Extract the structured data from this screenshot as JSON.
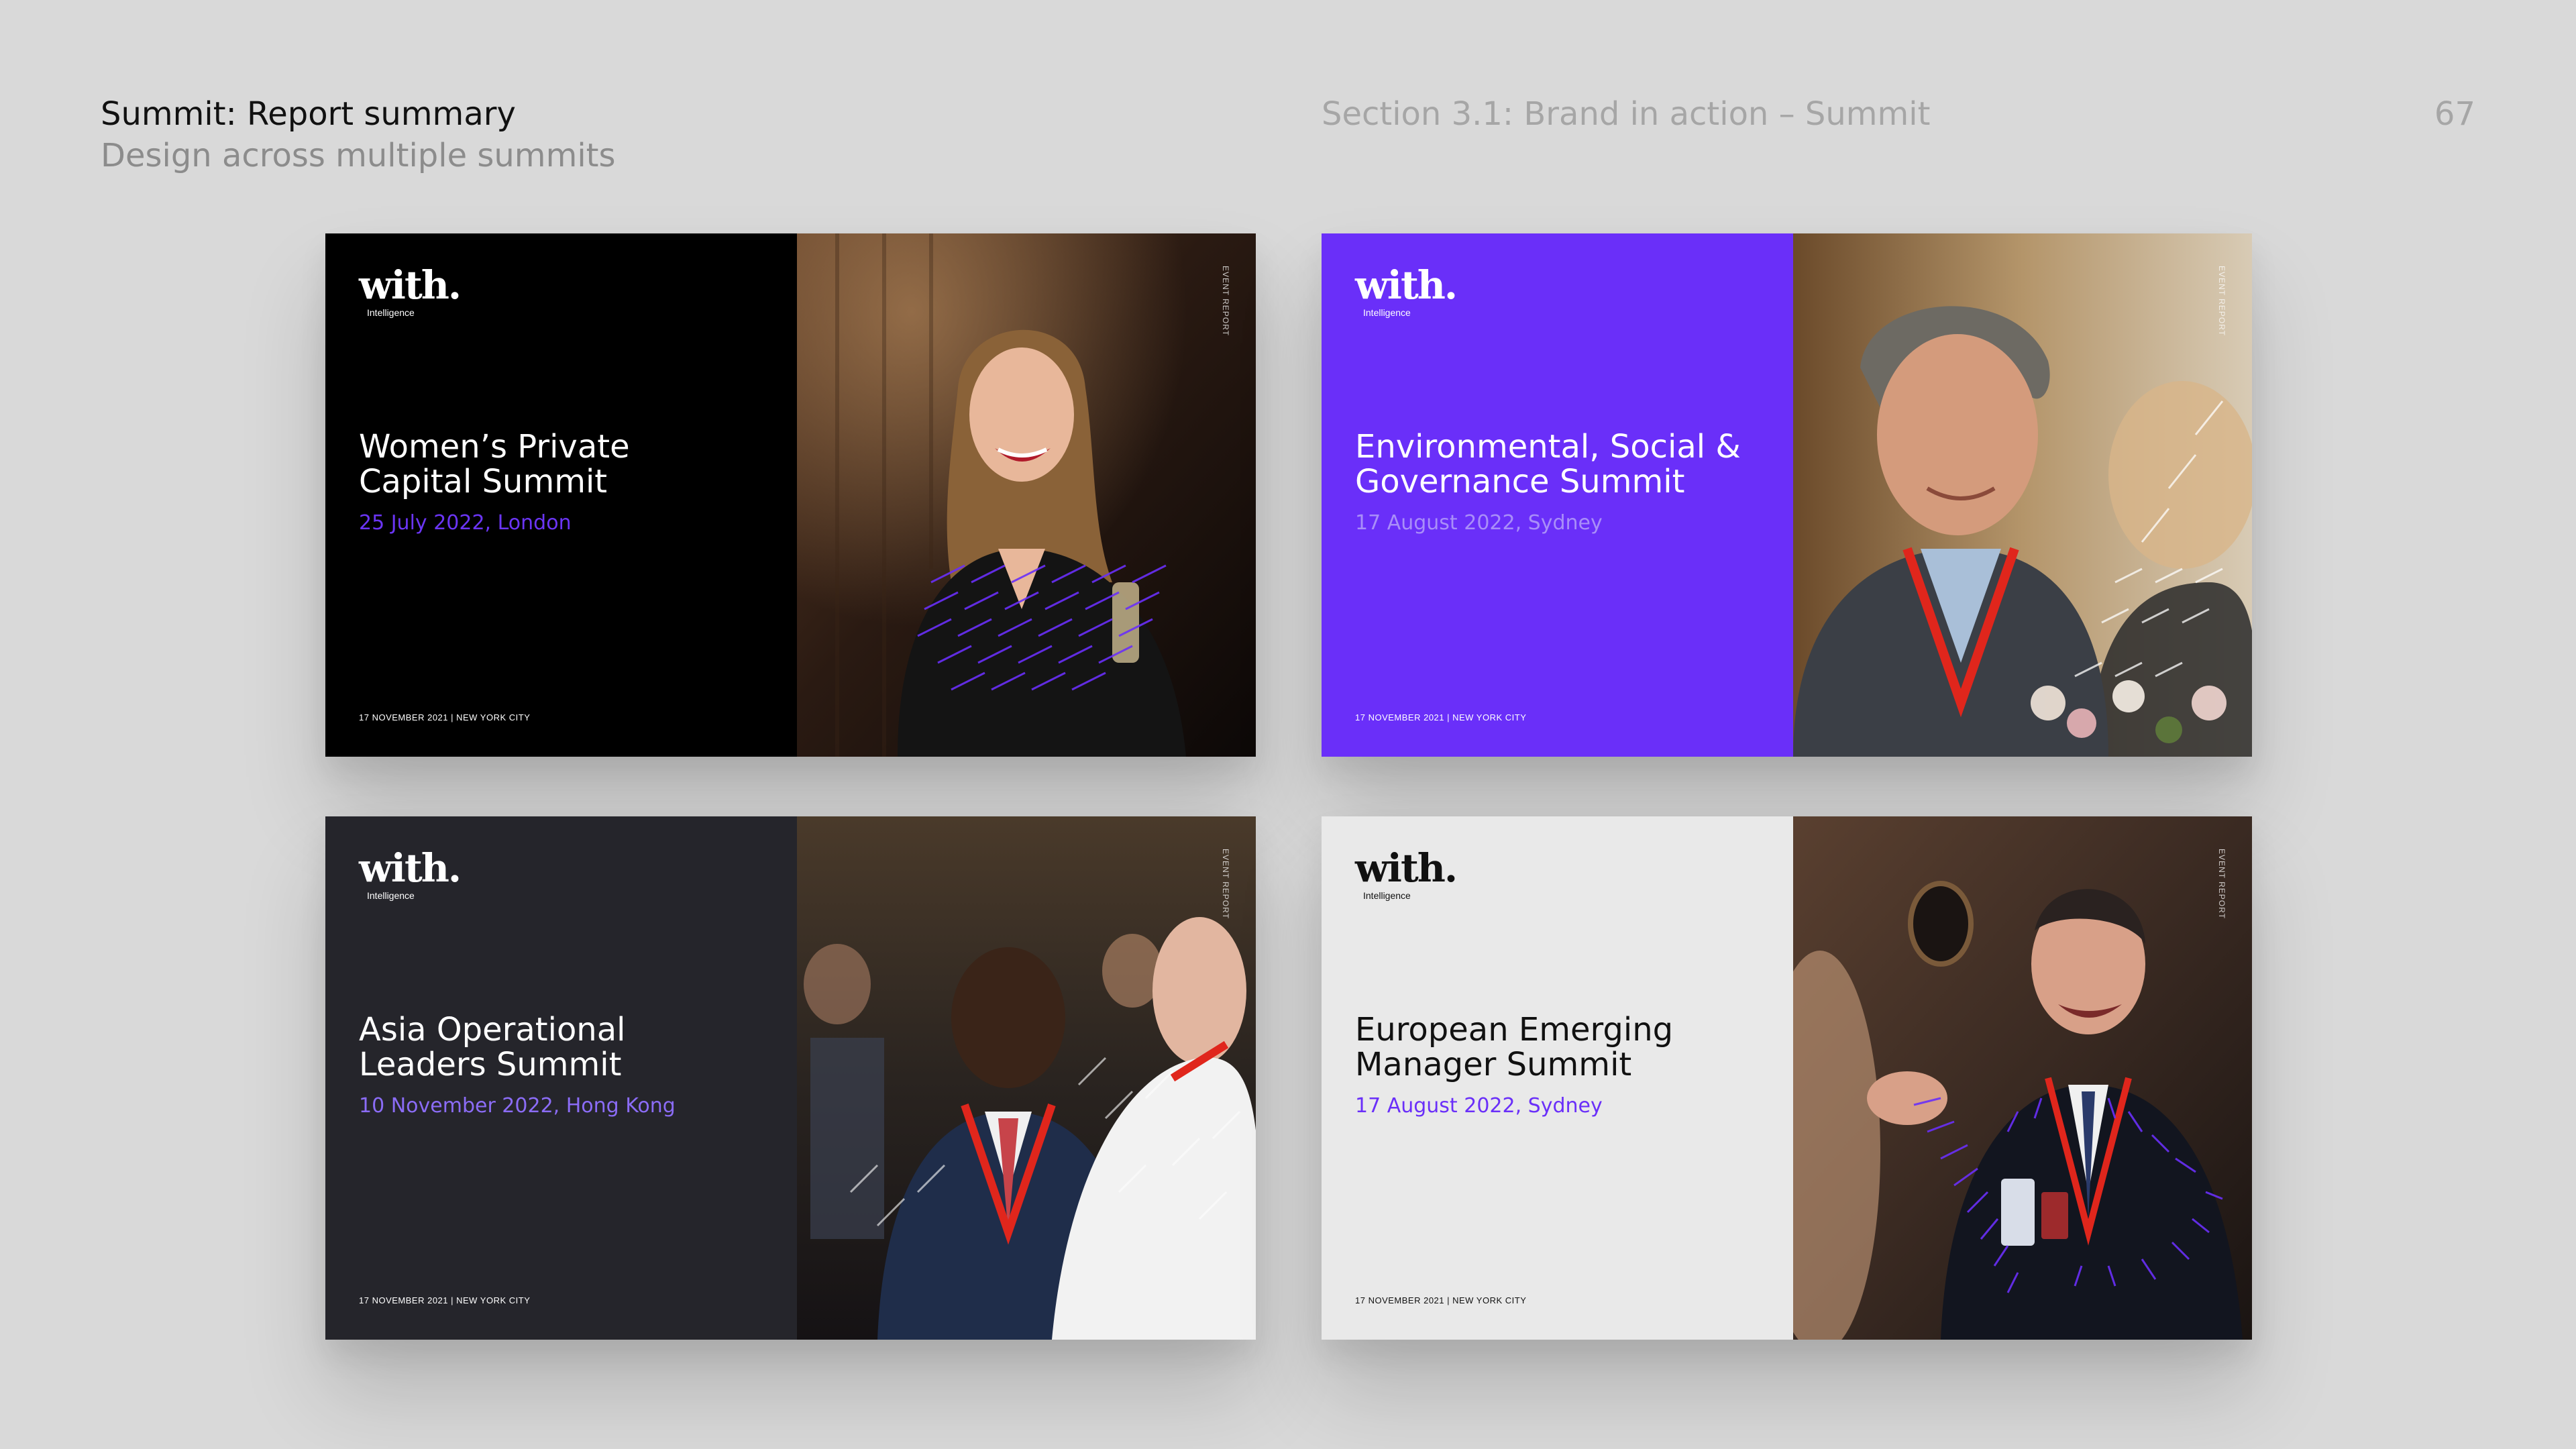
{
  "header": {
    "title": "Summit: Report summary",
    "subtitle": "Design across multiple summits",
    "section": "Section 3.1: Brand in action – Summit",
    "page_number": "67"
  },
  "colors": {
    "background": "#d9d9d9",
    "brand_purple": "#6a2ff9",
    "black": "#000000",
    "charcoal": "#25252b",
    "light_grey": "#e9e9e9"
  },
  "cards": [
    {
      "logo": "with.",
      "logo_sub": "Intelligence",
      "title_line1": "Women’s Private",
      "title_line2": "Capital Summit",
      "date": "25 July 2022, London",
      "footer": "17 NOVEMBER 2021  |  NEW YORK CITY",
      "vertical_tag": "EVENT REPORT",
      "photo_alt": "woman-laughing-photo"
    },
    {
      "logo": "with.",
      "logo_sub": "Intelligence",
      "title_line1": "Environmental, Social &",
      "title_line2": "Governance Summit",
      "date": "17 August 2022, Sydney",
      "footer": "17 NOVEMBER 2021  |  NEW YORK CITY",
      "vertical_tag": "EVENT REPORT",
      "photo_alt": "man-smiling-photo"
    },
    {
      "logo": "with.",
      "logo_sub": "Intelligence",
      "title_line1": "Asia Operational",
      "title_line2": "Leaders Summit",
      "date": "10 November 2022, Hong Kong",
      "footer": "17 NOVEMBER 2021  |  NEW YORK CITY",
      "vertical_tag": "EVENT REPORT",
      "photo_alt": "men-talking-photo"
    },
    {
      "logo": "with.",
      "logo_sub": "Intelligence",
      "title_line1": "European Emerging",
      "title_line2": "Manager Summit",
      "date": "17 August 2022, Sydney",
      "footer": "17 NOVEMBER 2021  |  NEW YORK CITY",
      "vertical_tag": "EVENT REPORT",
      "photo_alt": "man-laughing-photo"
    }
  ]
}
